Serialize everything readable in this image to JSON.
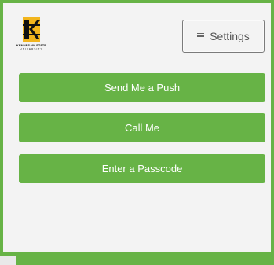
{
  "logo": {
    "icon": "kennesaw-state-logo",
    "name_line": "KENNESAW STATE",
    "sub_line": "UNIVERSITY"
  },
  "settings": {
    "label": "Settings",
    "icon": "hamburger-icon"
  },
  "methods": [
    {
      "label": "Send Me a Push"
    },
    {
      "label": "Call Me"
    },
    {
      "label": "Enter a Passcode"
    }
  ],
  "colors": {
    "accent": "#67b346",
    "panel": "#f3f3f3",
    "button_text": "#ffffff",
    "settings_text": "#555555"
  }
}
